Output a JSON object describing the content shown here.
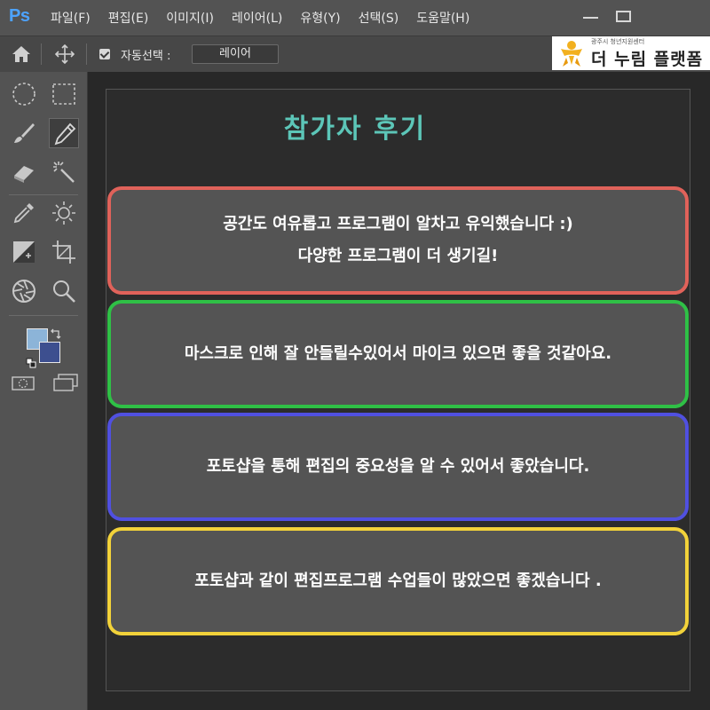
{
  "app": {
    "logo": "Ps"
  },
  "menu": [
    "파일(F)",
    "편집(E)",
    "이미지(I)",
    "레이어(L)",
    "유형(Y)",
    "선택(S)",
    "도움말(H)"
  ],
  "options": {
    "auto_select_label": "자동선택 :",
    "auto_select_checked": true,
    "auto_select_value": "레이어"
  },
  "brand": {
    "small_text": "광주시 청년지원센터",
    "name": "더 누림 플랫폼"
  },
  "tools": [
    "elliptical-marquee",
    "rectangular-marquee",
    "brush",
    "pencil",
    "eraser",
    "magic-wand",
    "eyedropper",
    "dodge-sun",
    "gradient",
    "crop",
    "aperture",
    "zoom"
  ],
  "colors": {
    "foreground": "#8cb4d8",
    "background": "#3d4f8f",
    "title": "#5cc6b8"
  },
  "canvas": {
    "title": "참가자 후기",
    "cards": [
      {
        "color": "#e0625a",
        "lines": [
          "공간도 여유롭고 프로그램이 알차고 유익했습니다 :)",
          "다양한 프로그램이 더 생기길!"
        ]
      },
      {
        "color": "#2fc046",
        "lines": [
          "마스크로 인해 잘 안들릴수있어서 마이크 있으면  좋을 것같아요."
        ]
      },
      {
        "color": "#5050e0",
        "lines": [
          "포토샵을 통해 편집의 중요성을 알 수 있어서 좋았습니다."
        ]
      },
      {
        "color": "#f2d23a",
        "lines": [
          "포토샵과 같이 편집프로그램 수업들이 많았으면 좋겠습니다 ."
        ]
      }
    ]
  }
}
